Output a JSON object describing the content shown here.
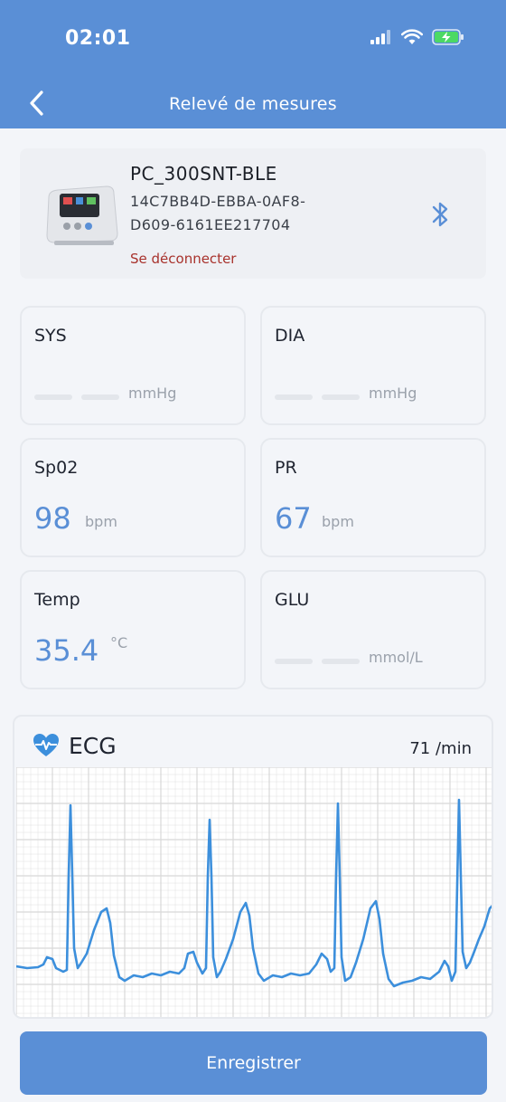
{
  "status_bar": {
    "time": "02:01"
  },
  "nav": {
    "title": "Relevé de mesures",
    "back_icon": "chevron-left-icon"
  },
  "device": {
    "name": "PC_300SNT-BLE",
    "id_line1": "14C7BB4D-EBBA-0AF8-",
    "id_line2": "D609-6161EE217704",
    "disconnect_label": "Se déconnecter",
    "bluetooth_icon": "bluetooth-icon"
  },
  "tiles": {
    "sys": {
      "label": "SYS",
      "unit": "mmHg"
    },
    "dia": {
      "label": "DIA",
      "unit": "mmHg"
    },
    "spo2": {
      "label": "Sp02",
      "value": "98",
      "unit": "bpm"
    },
    "pr": {
      "label": "PR",
      "value": "67",
      "unit": "bpm"
    },
    "temp": {
      "label": "Temp",
      "value": "35.4",
      "unit": "°C"
    },
    "glu": {
      "label": "GLU",
      "unit": "mmol/L"
    }
  },
  "ecg": {
    "title": "ECG",
    "rate": "71 /min",
    "icon": "heart-pulse-icon"
  },
  "actions": {
    "save_label": "Enregistrer"
  },
  "colors": {
    "accent": "#5a8fd6",
    "danger": "#a8322c",
    "ecg_line": "#3c8fdc"
  }
}
